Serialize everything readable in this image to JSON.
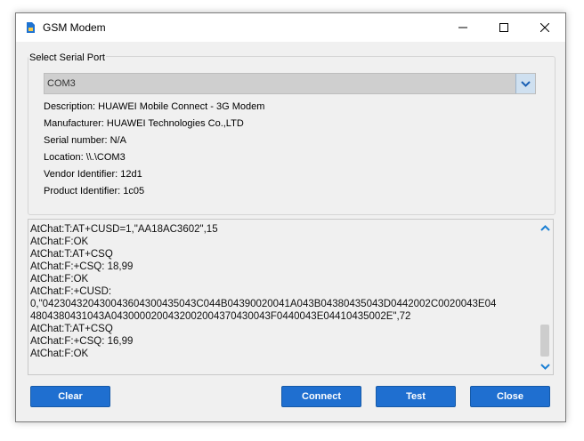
{
  "window": {
    "title": "GSM Modem"
  },
  "serial_group": {
    "label": "Select Serial Port",
    "selected_port": "COM3",
    "details": [
      "Description: HUAWEI Mobile Connect - 3G Modem",
      "Manufacturer: HUAWEI Technologies Co.,LTD",
      "Serial number: N/A",
      "Location: \\\\.\\COM3",
      "Vendor Identifier: 12d1",
      "Product Identifier: 1c05"
    ]
  },
  "log": {
    "lines": [
      "AtChat:T:AT+CUSD=1,\"AA18AC3602\",15",
      "AtChat:F:OK",
      "AtChat:T:AT+CSQ",
      "AtChat:F:+CSQ: 18,99",
      "AtChat:F:OK",
      "AtChat:F:+CUSD:",
      "0,\"04230432043004360430043504 3C044B04390020041A043B04380435043D0442002C0020043E04",
      "4804380431043A0430000200432002004370430043F0440043E04410435002E\",72",
      "AtChat:T:AT+CSQ",
      "AtChat:F:+CSQ: 16,99",
      "AtChat:F:OK"
    ]
  },
  "buttons": {
    "clear": "Clear",
    "connect": "Connect",
    "test": "Test",
    "close": "Close"
  },
  "colors": {
    "accent": "#1f6fd0"
  }
}
